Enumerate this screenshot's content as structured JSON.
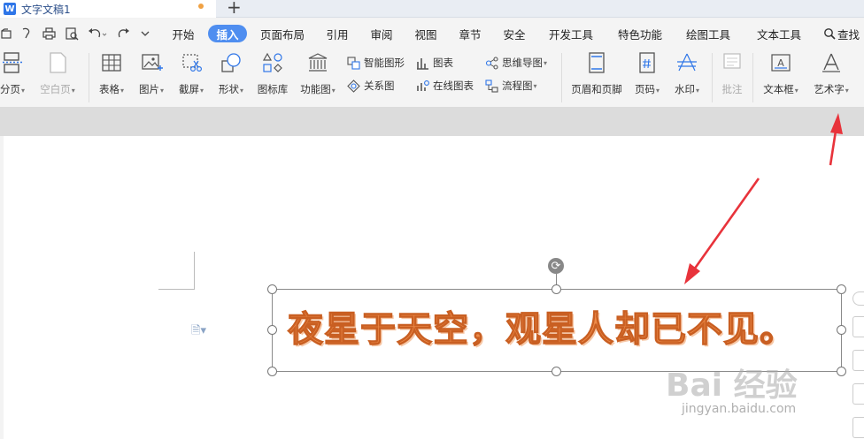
{
  "window": {
    "doc_name": "文字文稿1",
    "logo_letter": "W",
    "new_tab_symbol": "+"
  },
  "menubar": {
    "tabs": [
      {
        "key": "start",
        "label": "开始",
        "active": false
      },
      {
        "key": "insert",
        "label": "插入",
        "active": true
      },
      {
        "key": "layout",
        "label": "页面布局",
        "active": false
      },
      {
        "key": "reference",
        "label": "引用",
        "active": false
      },
      {
        "key": "review",
        "label": "审阅",
        "active": false
      },
      {
        "key": "view",
        "label": "视图",
        "active": false
      },
      {
        "key": "chapter",
        "label": "章节",
        "active": false
      },
      {
        "key": "security",
        "label": "安全",
        "active": false
      },
      {
        "key": "devtools",
        "label": "开发工具",
        "active": false
      },
      {
        "key": "features",
        "label": "特色功能",
        "active": false
      },
      {
        "key": "drawtools",
        "label": "绘图工具",
        "active": false
      },
      {
        "key": "texttools",
        "label": "文本工具",
        "active": false
      }
    ],
    "search_label": "查找"
  },
  "ribbon": {
    "page_break": "分页",
    "blank_page": "空白页",
    "table": "表格",
    "picture": "图片",
    "screenshot": "截屏",
    "shape": "形状",
    "icon_lib": "图标库",
    "func_chart": "功能图",
    "smart_shape": "智能图形",
    "chart": "图表",
    "mind_map": "思维导图",
    "relation_chart": "关系图",
    "online_chart": "在线图表",
    "flowchart": "流程图",
    "header_footer": "页眉和页脚",
    "page_number": "页码",
    "watermark": "水印",
    "comment": "批注",
    "textbox": "文本框",
    "word_art": "艺术字"
  },
  "document": {
    "word_art_text": "夜星于天空，观星人却已不见。"
  },
  "watermark": {
    "brand": "Bai 经验",
    "url": "jingyan.baidu.com"
  },
  "colors": {
    "accent": "#4f8ef0",
    "word_art_fill": "#ef8c4a",
    "word_art_stroke": "#c95f22",
    "arrow": "#e8333b"
  }
}
